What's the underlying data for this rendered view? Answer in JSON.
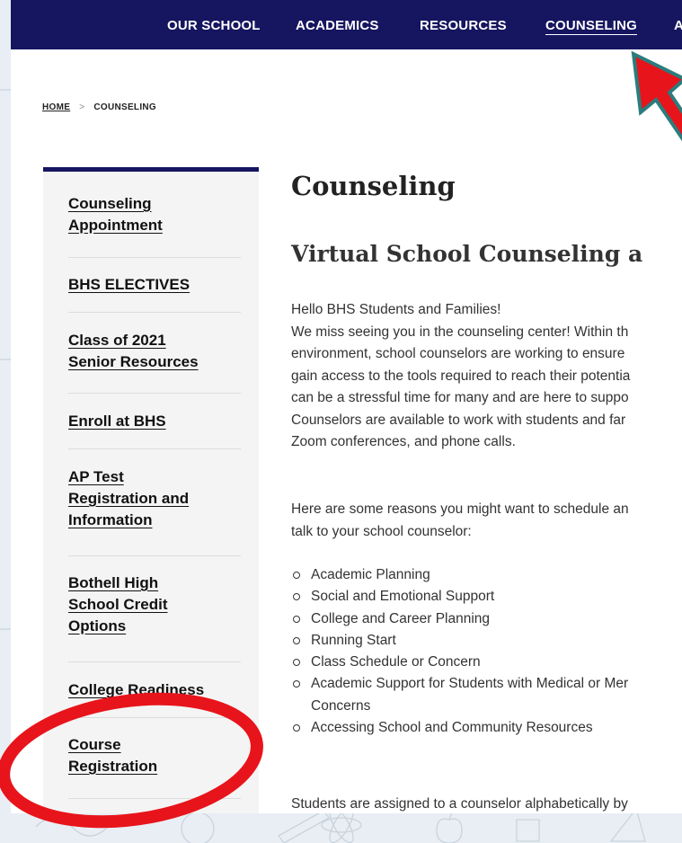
{
  "nav": {
    "items": [
      {
        "label": "OUR SCHOOL",
        "active": false
      },
      {
        "label": "ACADEMICS",
        "active": false
      },
      {
        "label": "RESOURCES",
        "active": false
      },
      {
        "label": "COUNSELING",
        "active": true
      },
      {
        "label": "A",
        "active": false
      }
    ]
  },
  "breadcrumb": {
    "home": "HOME",
    "separator": ">",
    "current": "COUNSELING"
  },
  "sidebar": {
    "items": [
      {
        "lines": [
          "Counseling",
          "Appointment"
        ]
      },
      {
        "lines": [
          "BHS ELECTIVES"
        ]
      },
      {
        "lines": [
          "Class of 2021",
          "Senior Resources"
        ]
      },
      {
        "lines": [
          "Enroll at BHS"
        ]
      },
      {
        "lines": [
          "AP Test",
          "Registration and",
          "Information"
        ]
      },
      {
        "lines": [
          "Bothell High",
          "School Credit",
          "Options"
        ]
      },
      {
        "lines": [
          "College Readiness"
        ]
      },
      {
        "lines": [
          "Course",
          "Registration"
        ]
      }
    ]
  },
  "main": {
    "title": "Counseling",
    "subtitle": "Virtual School Counseling a",
    "intro_lines": [
      "Hello BHS Students and Families!",
      "We miss seeing you in the counseling center! Within th",
      "environment, school counselors are working to ensure",
      "gain access to the tools required to reach their potentia",
      "can be a stressful time for many and are here to suppo",
      "Counselors are available to work with students and far",
      "Zoom conferences, and phone calls."
    ],
    "reasons_intro_lines": [
      "Here are some reasons you might want to schedule an",
      "talk to your school counselor:"
    ],
    "reasons": [
      {
        "lines": [
          "Academic Planning"
        ]
      },
      {
        "lines": [
          "Social and Emotional Support"
        ]
      },
      {
        "lines": [
          "College and Career Planning"
        ]
      },
      {
        "lines": [
          "Running Start"
        ]
      },
      {
        "lines": [
          "Class Schedule or Concern"
        ]
      },
      {
        "lines": [
          "Academic Support for Students with Medical or Mer",
          "Concerns"
        ]
      },
      {
        "lines": [
          "Accessing School and Community Resources"
        ]
      }
    ],
    "after_line": "Students are assigned to a counselor alphabetically by"
  },
  "colors": {
    "nav_bg": "#161560",
    "annotation_red": "#e8141b",
    "arrow_outline": "#2a7d7d",
    "sidebar_bg": "#f4f4f4"
  }
}
